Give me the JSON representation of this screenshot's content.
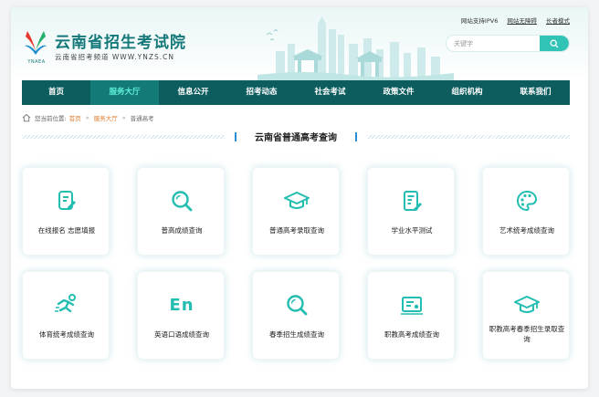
{
  "header": {
    "logo_text": "YNAEA",
    "title": "云南省招生考试院",
    "subtitle": "云南省招考频道 WWW.YNZS.CN",
    "links": {
      "ipv6": "网站支持IPV6",
      "accessible": "网站无障碍",
      "elder": "长者模式"
    },
    "search": {
      "placeholder": "关键字",
      "value": ""
    }
  },
  "nav": {
    "items": [
      {
        "label": "首页",
        "active": false
      },
      {
        "label": "服务大厅",
        "active": true
      },
      {
        "label": "信息公开",
        "active": false
      },
      {
        "label": "招考动态",
        "active": false
      },
      {
        "label": "社会考试",
        "active": false
      },
      {
        "label": "政策文件",
        "active": false
      },
      {
        "label": "组织机构",
        "active": false
      },
      {
        "label": "联系我们",
        "active": false
      }
    ]
  },
  "breadcrumb": {
    "prefix": "您当前位置:",
    "items": [
      "首页",
      "服务大厅",
      "普通高考"
    ],
    "separator": "»"
  },
  "section": {
    "title": "云南省普通高考查询"
  },
  "cards": [
    {
      "label": "在线报名 志愿填报",
      "icon": "edit-document-icon"
    },
    {
      "label": "普高成绩查询",
      "icon": "search-magnifier-icon"
    },
    {
      "label": "普通高考录取查询",
      "icon": "graduation-cap-icon"
    },
    {
      "label": "学业水平测试",
      "icon": "checklist-edit-icon"
    },
    {
      "label": "艺术统考成绩查询",
      "icon": "palette-icon"
    },
    {
      "label": "体育统考成绩查询",
      "icon": "runner-icon"
    },
    {
      "label": "英语口语成绩查询",
      "icon": "english-en-icon",
      "icon_text": "En"
    },
    {
      "label": "春季招生成绩查询",
      "icon": "search-magnifier-icon"
    },
    {
      "label": "职教高考成绩查询",
      "icon": "certificate-icon"
    },
    {
      "label": "职教高考春季招生录取查询",
      "icon": "graduation-cap-icon"
    }
  ],
  "colors": {
    "accent": "#23bdb1",
    "nav_bg": "#0d5c5e",
    "nav_active_text": "#5ff0d8",
    "title": "#14787a",
    "crumb_link": "#e07a2a"
  }
}
